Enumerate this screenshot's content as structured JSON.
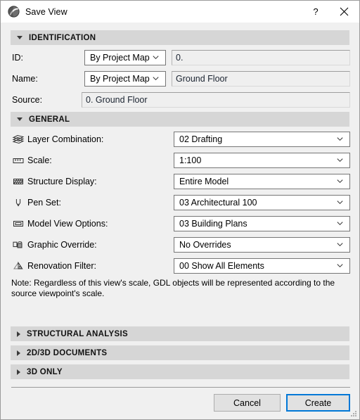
{
  "window": {
    "title": "Save View",
    "app_icon": "archicad-globe-icon",
    "help_label": "?",
    "close_label": "close-icon"
  },
  "sections": {
    "identification": {
      "title": "IDENTIFICATION",
      "expanded": true,
      "rows": {
        "id": {
          "label": "ID:",
          "mode": "By Project Map",
          "value": "0."
        },
        "name": {
          "label": "Name:",
          "mode": "By Project Map",
          "value": "Ground Floor"
        },
        "source": {
          "label": "Source:",
          "value": "0. Ground Floor"
        }
      }
    },
    "general": {
      "title": "GENERAL",
      "expanded": true,
      "rows": [
        {
          "icon": "layers-icon",
          "label": "Layer Combination:",
          "value": "02 Drafting"
        },
        {
          "icon": "ruler-icon",
          "label": "Scale:",
          "value": "1:100"
        },
        {
          "icon": "structure-hatch-icon",
          "label": "Structure Display:",
          "value": "Entire Model"
        },
        {
          "icon": "pen-icon",
          "label": "Pen Set:",
          "value": "03 Architectural 100"
        },
        {
          "icon": "model-view-icon",
          "label": "Model View Options:",
          "value": "03 Building Plans"
        },
        {
          "icon": "graphic-override-icon",
          "label": "Graphic Override:",
          "value": "No Overrides"
        },
        {
          "icon": "renovation-house-icon",
          "label": "Renovation Filter:",
          "value": "00 Show All Elements"
        }
      ],
      "note": "Note: Regardless of this view's scale, GDL objects will be represented according to the source viewpoint's scale."
    },
    "collapsed": [
      {
        "title": "STRUCTURAL ANALYSIS"
      },
      {
        "title": "2D/3D DOCUMENTS"
      },
      {
        "title": "3D ONLY"
      }
    ]
  },
  "footer": {
    "cancel_label": "Cancel",
    "create_label": "Create"
  },
  "colors": {
    "dialog_background": "#f0f0f0",
    "section_header": "#d6d6d6",
    "focus_blue": "#0078d7",
    "field_border": "#767676"
  }
}
